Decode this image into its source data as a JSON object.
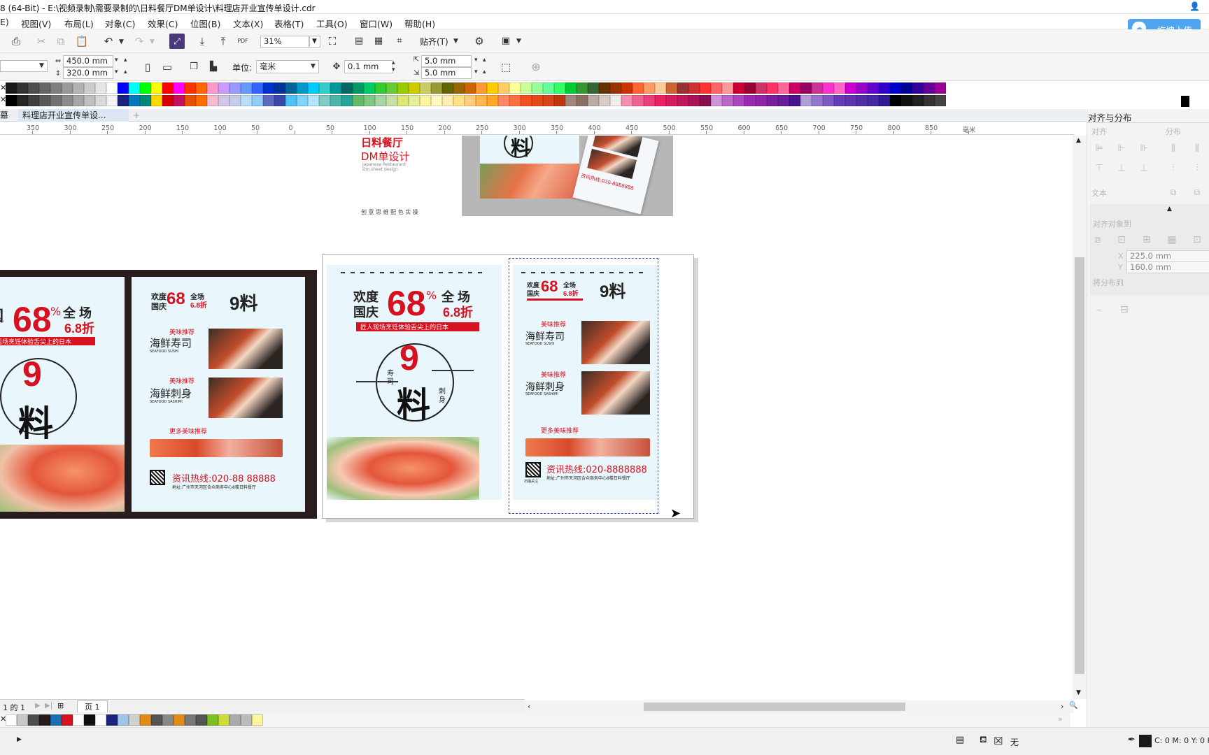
{
  "window": {
    "title": "8 (64-Bit) - E:\\视频录制\\需要录制的\\日料餐厅DM单设计\\料理店开业宣传单设计.cdr"
  },
  "menu": [
    "E)",
    "视图(V)",
    "布局(L)",
    "对象(C)",
    "效果(C)",
    "位图(B)",
    "文本(X)",
    "表格(T)",
    "工具(O)",
    "窗口(W)",
    "帮助(H)"
  ],
  "upload_button": "拖拽上传",
  "toolbar": {
    "zoom": "31%",
    "snap": "贴齐(T)",
    "pdf": "PDF"
  },
  "propbar": {
    "width": "450.0 mm",
    "height": "320.0 mm",
    "unit_label": "单位:",
    "unit_value": "毫米",
    "nudge": "0.1 mm",
    "dup_x": "5.0 mm",
    "dup_y": "5.0 mm"
  },
  "palette": {
    "row1": [
      "#1a1a1a",
      "#333333",
      "#4d4d4d",
      "#666666",
      "#808080",
      "#999999",
      "#b3b3b3",
      "#cccccc",
      "#e6e6e6",
      "#ffffff",
      "#0000ff",
      "#00ffff",
      "#00ff00",
      "#ffff00",
      "#ff0000",
      "#ff00ff",
      "#ff3300",
      "#ff6600",
      "#ff99cc",
      "#cc99ff",
      "#9999ff",
      "#6699ff",
      "#3366ff",
      "#0033cc",
      "#003399",
      "#006699",
      "#0099cc",
      "#00ccff",
      "#33cccc",
      "#009999",
      "#006666",
      "#009966",
      "#00cc66",
      "#33cc33",
      "#66cc33",
      "#99cc00",
      "#cccc00",
      "#cccc66",
      "#999933",
      "#666600",
      "#996600",
      "#cc6600",
      "#ff9933",
      "#ffcc00",
      "#ffcc66",
      "#ffff99",
      "#ccff99",
      "#99ff99",
      "#66ff99",
      "#33ff66",
      "#00cc33",
      "#339933",
      "#336633",
      "#663300",
      "#993300",
      "#cc3300",
      "#ff6633",
      "#ff9966",
      "#ffcc99",
      "#cc6633",
      "#993333",
      "#cc3333",
      "#ff3333",
      "#ff6666",
      "#ff9999",
      "#cc0033",
      "#990033",
      "#cc3366",
      "#ff3366",
      "#ff6699",
      "#cc0066",
      "#990066",
      "#cc3399",
      "#ff33cc",
      "#ff66cc",
      "#cc00cc",
      "#9900cc",
      "#6600cc",
      "#3300cc",
      "#0000cc",
      "#000099",
      "#330099",
      "#660099",
      "#990099"
    ],
    "row2": [
      "#000000",
      "#262626",
      "#404040",
      "#595959",
      "#737373",
      "#8c8c8c",
      "#a6a6a6",
      "#bfbfbf",
      "#d9d9d9",
      "#f2f2f2",
      "#1a237e",
      "#0277bd",
      "#00897b",
      "#ffd600",
      "#d50000",
      "#c51162",
      "#e65100",
      "#ff6d00",
      "#f8bbd0",
      "#d1c4e9",
      "#c5cae9",
      "#bbdefb",
      "#90caf9",
      "#5c6bc0",
      "#3949ab",
      "#4fc3f7",
      "#81d4fa",
      "#b3e5fc",
      "#80cbc4",
      "#4db6ac",
      "#26a69a",
      "#66bb6a",
      "#81c784",
      "#a5d6a7",
      "#c5e1a5",
      "#dce775",
      "#e6ee9c",
      "#fff59d",
      "#fff9c4",
      "#ffecb3",
      "#ffe082",
      "#ffcc80",
      "#ffb74d",
      "#ffa726",
      "#ff8a65",
      "#ff7043",
      "#f4511e",
      "#e64a19",
      "#d84315",
      "#bf360c",
      "#a1887f",
      "#8d6e63",
      "#bcaaa4",
      "#d7ccc8",
      "#efebe9",
      "#f48fb1",
      "#f06292",
      "#ec407a",
      "#e91e63",
      "#d81b60",
      "#c2185b",
      "#ad1457",
      "#880e4f",
      "#ce93d8",
      "#ba68c8",
      "#ab47bc",
      "#9c27b0",
      "#8e24aa",
      "#7b1fa2",
      "#6a1b9a",
      "#4a148c",
      "#b39ddb",
      "#9575cd",
      "#7e57c2",
      "#673ab7",
      "#5e35b1",
      "#512da8",
      "#4527a0",
      "#311b92",
      "#000000",
      "#111111",
      "#222222",
      "#333333",
      "#444444"
    ]
  },
  "doc_tabs": {
    "left": "幕",
    "active": "料理店开业宣传单设..."
  },
  "ruler_labels": [
    "350",
    "300",
    "250",
    "200",
    "150",
    "100",
    "50",
    "0",
    "50",
    "100",
    "150",
    "200",
    "250",
    "300",
    "350",
    "400",
    "450",
    "500",
    "550",
    "600",
    "650",
    "700",
    "750",
    "800",
    "850",
    "毫米"
  ],
  "canvas": {
    "cover": {
      "line1": "日料餐厅",
      "line2": "DM单设计",
      "sub1": "Japanese Restaurant",
      "sub2": "Dm.sheet design",
      "tags": "创 意   思 维   配 色   实 操"
    },
    "flyer": {
      "left_title_a": "欢度",
      "left_title_b": "国庆",
      "percent": "68",
      "pct_sign": "%",
      "right_title_a": "全 场",
      "right_title_b": "6.8折",
      "banner": "匠人现场烹饪体验舌尖上的日本",
      "logo_char": "料",
      "logo_left": "寿\n司",
      "logo_right": "刺\n身",
      "promo_small": "欢度",
      "promo_small2": "国庆",
      "promo_pct": "68",
      "promo_full": "全场",
      "promo_off": "6.8折",
      "brand": "9料",
      "rec_tag": "美味推荐",
      "item1": "海鲜寿司",
      "item1_en": "SEAFOOD SUSHI",
      "item2": "海鲜刺身",
      "item2_en": "SEAFOOD SASHIMI",
      "more": "更多美味推荐",
      "hotline": "资讯热线:020-8888888",
      "hotline_left": "资讯热线:020-88 88888",
      "address": "地址:广州市天河区合众商务中心8楼日料餐厅",
      "qr_label": "扫描关注"
    }
  },
  "page_nav": {
    "counter": "1 的 1",
    "page_tab": "页 1"
  },
  "doc_palette": [
    "#ffffff",
    "#c8c8c8",
    "#4d4d4d",
    "#2a1a1a",
    "#1a6fb5",
    "#d7111f",
    "#ffffff",
    "#111111",
    "#ffffff",
    "#1a237e",
    "#9ec5e8",
    "#cfcfcf",
    "#e48a14",
    "#555555",
    "#888888",
    "#e48a14",
    "#777777",
    "#555555",
    "#7cbf22",
    "#cddc39",
    "#aaaaaa",
    "#bbbbbb",
    "#fff59d"
  ],
  "status": {
    "fill": "无",
    "color": "C: 0 M: 0 Y: 0 K"
  },
  "right_panel": {
    "title": "对齐与分布",
    "align": "对齐",
    "distribute": "分布",
    "text": "文本",
    "objects_distance": "对齐对象到",
    "x": "225.0 mm",
    "y": "160.0 mm",
    "spacing": "将分布到"
  }
}
